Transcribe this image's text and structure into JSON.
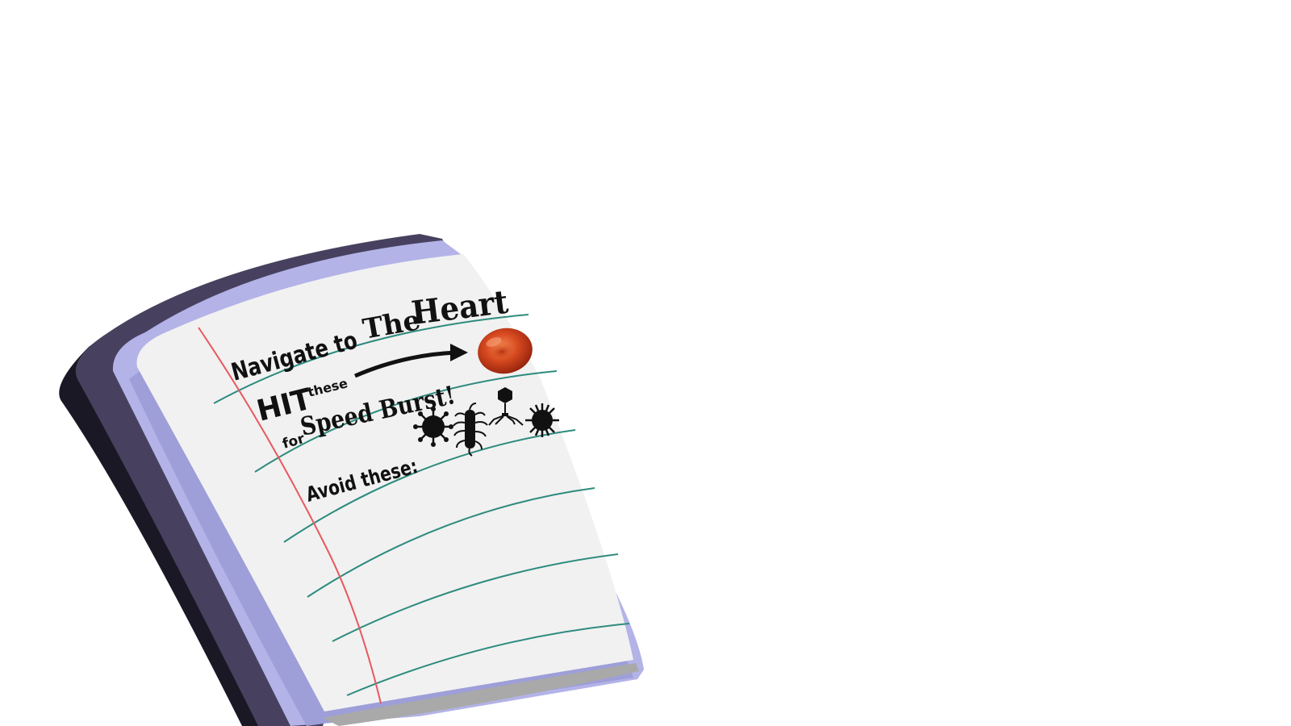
{
  "note": {
    "line_navigate": "Navigate to",
    "line_the": "The",
    "line_heart": "Heart",
    "line_hit": "HIT",
    "line_these": "these",
    "line_for": "for",
    "line_speed_burst": "Speed Burst!",
    "line_avoid": "Avoid these:"
  },
  "icons": {
    "arrow": "arrow-right-icon",
    "blood_cell": "red-blood-cell-icon",
    "virus": "virus-icon",
    "bacterium": "bacterium-icon",
    "phage": "bacteriophage-icon",
    "spiky_germ": "spiky-germ-icon"
  },
  "colors": {
    "paper": "#f1f1f1",
    "paper_back": "#b3b3e8",
    "stack_dark": "#47415f",
    "ruled_line": "#2e8b7e",
    "margin_line": "#e8585f",
    "blood_cell": "#d84a20"
  }
}
